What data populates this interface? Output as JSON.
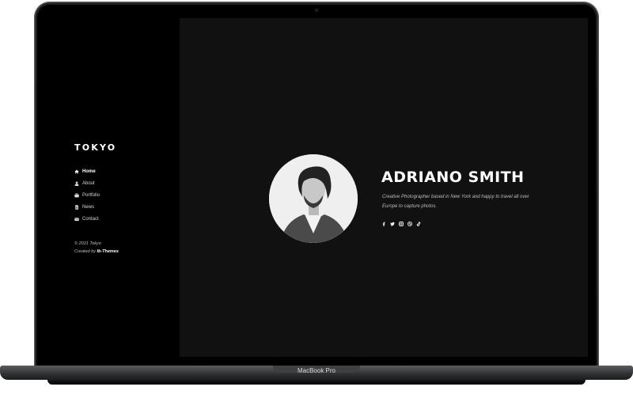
{
  "device": {
    "label": "MacBook Pro"
  },
  "sidebar": {
    "logo": "TOKYO",
    "menu": [
      {
        "label": "Home",
        "icon": "home-icon",
        "active": true
      },
      {
        "label": "About",
        "icon": "user-icon",
        "active": false
      },
      {
        "label": "Portfolio",
        "icon": "briefcase-icon",
        "active": false
      },
      {
        "label": "News",
        "icon": "document-icon",
        "active": false
      },
      {
        "label": "Contact",
        "icon": "envelope-icon",
        "active": false
      }
    ],
    "copyright": "© 2021 Tokyo",
    "credit_prefix": "Created by",
    "credit_author": "Ib-Themes"
  },
  "hero": {
    "name": "ADRIANO SMITH",
    "bio": "Creative Photographer based in New York and happy to travel all over Europe to capture photos.",
    "social": [
      "facebook-icon",
      "twitter-icon",
      "instagram-icon",
      "dribbble-icon",
      "tiktok-icon"
    ]
  },
  "colors": {
    "sidebar_bg": "#000000",
    "content_bg": "#111112",
    "text": "#ffffff",
    "muted": "#bdbdbd"
  }
}
